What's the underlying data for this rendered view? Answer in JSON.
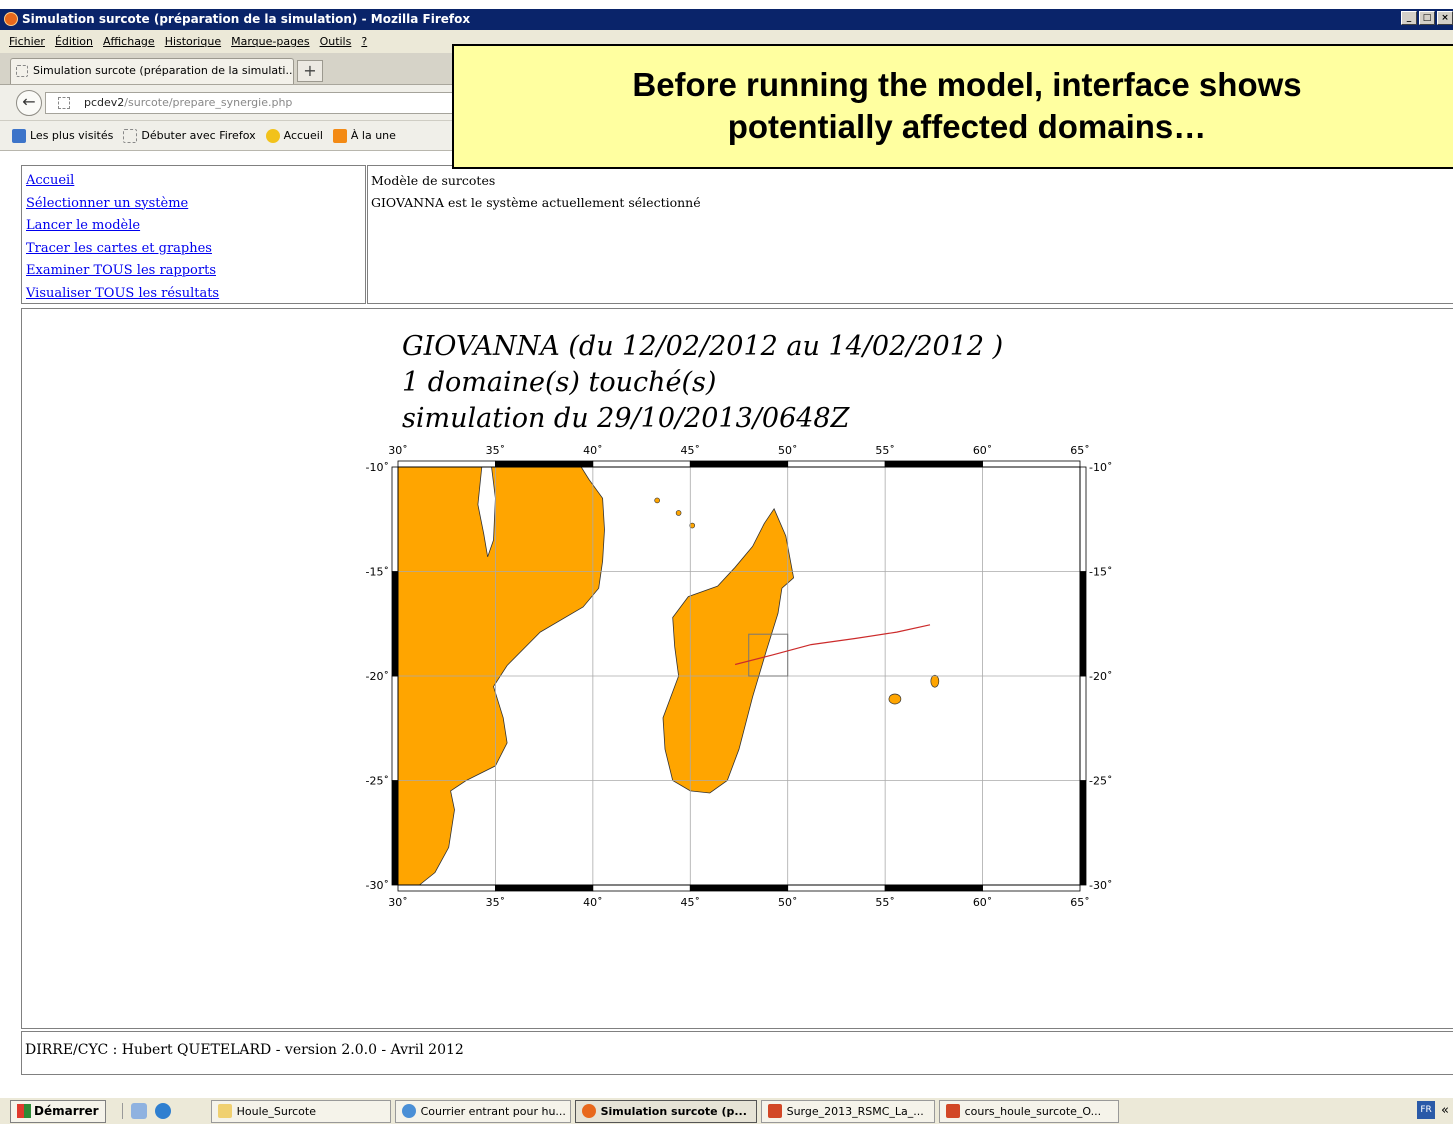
{
  "window": {
    "title": "Simulation surcote (préparation de la simulation) - Mozilla Firefox",
    "controls": [
      "_",
      "□",
      "×"
    ]
  },
  "menu": [
    "Fichier",
    "Édition",
    "Affichage",
    "Historique",
    "Marque-pages",
    "Outils",
    "?"
  ],
  "tab": {
    "label": "Simulation surcote (préparation de la simulati...",
    "new_tab": "+"
  },
  "url": {
    "host": "pcdev2",
    "path": "/surcote/prepare_synergie.php"
  },
  "bookmarks": [
    {
      "label": "Les plus visités",
      "icon": "folder-icon",
      "color": "#3d74c9"
    },
    {
      "label": "Débuter avec Firefox",
      "icon": "page-icon",
      "color": "#ffffff"
    },
    {
      "label": "Accueil",
      "icon": "star-icon",
      "color": "#f2c21b"
    },
    {
      "label": "À la une",
      "icon": "rss-icon",
      "color": "#f38a14"
    }
  ],
  "callout": {
    "line1": "Before running the model, interface shows",
    "line2": "potentially affected domains…"
  },
  "nav_links": [
    "Accueil",
    "Sélectionner un système",
    "Lancer le modèle",
    "Tracer les cartes et graphes",
    "Examiner TOUS les rapports",
    "Visualiser TOUS les résultats"
  ],
  "info": {
    "line1": "Modèle de surcotes",
    "line2": "GIOVANNA est le système actuellement sélectionné"
  },
  "map": {
    "title1": "GIOVANNA (du  12/02/2012  au  14/02/2012 )",
    "title2": "1  domaine(s) touché(s)",
    "title3": "simulation du 29/10/2013/0648Z",
    "lon_labels": [
      "30˚",
      "35˚",
      "40˚",
      "45˚",
      "50˚",
      "55˚",
      "60˚",
      "65˚"
    ],
    "lat_labels": [
      "-10˚",
      "-15˚",
      "-20˚",
      "-25˚",
      "-30˚"
    ],
    "lon_range": [
      30,
      65
    ],
    "lat_range": [
      -30,
      -10
    ],
    "land_color": "#ffa500",
    "track_color": "#cc2b2b",
    "track": [
      [
        47.3,
        -19.45
      ],
      [
        49.2,
        -19.0
      ],
      [
        51.2,
        -18.5
      ],
      [
        53.5,
        -18.2
      ],
      [
        55.6,
        -17.9
      ],
      [
        57.3,
        -17.55
      ]
    ],
    "domain_box": {
      "lon": [
        48.0,
        50.0
      ],
      "lat": [
        -20.0,
        -18.0
      ]
    }
  },
  "footer": "DIRRE/CYC : Hubert QUETELARD - version 2.0.0 - Avril 2012",
  "taskbar": {
    "start": "Démarrer",
    "buttons": [
      {
        "label": "Houle_Surcote",
        "icon": "folder-icon",
        "color": "#f0d070"
      },
      {
        "label": "Courrier entrant pour hu...",
        "icon": "mail-icon",
        "color": "#4a8fd6"
      },
      {
        "label": "Simulation surcote (p...",
        "icon": "firefox-icon",
        "color": "#e8681c",
        "active": true
      },
      {
        "label": "Surge_2013_RSMC_La_...",
        "icon": "powerpoint-icon",
        "color": "#d24726"
      },
      {
        "label": "cours_houle_surcote_O...",
        "icon": "powerpoint-icon",
        "color": "#d24726"
      }
    ],
    "lang": "FR",
    "tray_arrow": "«"
  }
}
